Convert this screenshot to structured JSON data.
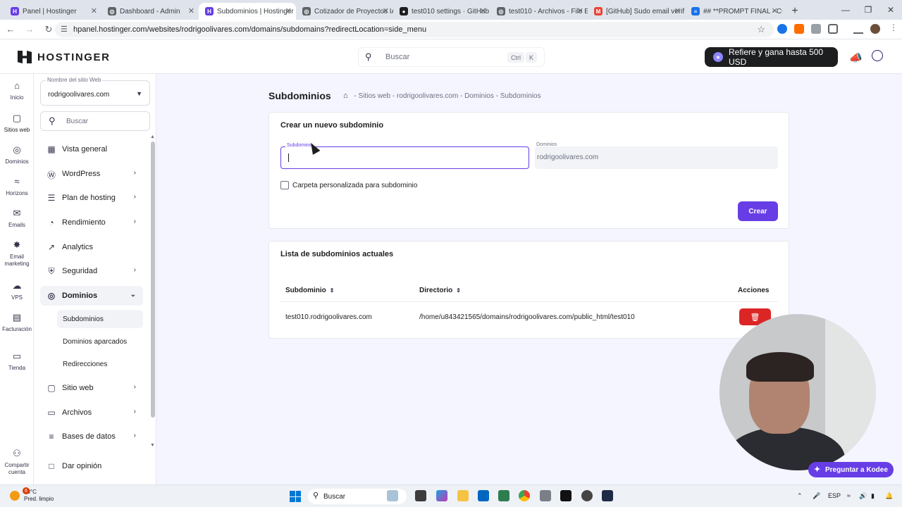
{
  "browser": {
    "tabs": [
      {
        "title": "Panel | Hostinger",
        "color": "#673de6",
        "glyph": "H"
      },
      {
        "title": "Dashboard - Admin",
        "color": "#5f6368",
        "glyph": "◎"
      },
      {
        "title": "Subdominios | Hostinger",
        "color": "#673de6",
        "glyph": "H",
        "active": true
      },
      {
        "title": "Cotizador de Proyectos IA",
        "color": "#5f6368",
        "glyph": "◎"
      },
      {
        "title": "test010 settings · GitHub",
        "color": "#1d1e20",
        "glyph": "●"
      },
      {
        "title": "test010 - Archivos - File E",
        "color": "#5f6368",
        "glyph": "◎"
      },
      {
        "title": "[GitHub] Sudo email verif",
        "color": "#ea4335",
        "glyph": "M"
      },
      {
        "title": "## **PROMPT FINAL - CO",
        "color": "#1a73e8",
        "glyph": "≡"
      }
    ],
    "url": "hpanel.hostinger.com/websites/rodrigoolivares.com/domains/subdomains?redirectLocation=side_menu"
  },
  "header": {
    "logo": "HOSTINGER",
    "search_placeholder": "Buscar",
    "search_kbd_1": "Ctrl",
    "search_kbd_2": "K",
    "refer_label": "Refiere y gana hasta 500 USD"
  },
  "rail": [
    {
      "label": "Inicio",
      "icon": "home-icon"
    },
    {
      "label": "Sitios web",
      "icon": "browser-icon",
      "active": true
    },
    {
      "label": "Dominios",
      "icon": "globe-icon"
    },
    {
      "label": "Horizons",
      "icon": "horizons-icon"
    },
    {
      "label": "Emails",
      "icon": "mail-icon"
    },
    {
      "label": "Email marketing",
      "icon": "sparkle-icon"
    },
    {
      "label": "VPS",
      "icon": "cloud-icon"
    },
    {
      "label": "Facturación",
      "icon": "billing-icon"
    },
    {
      "label": "Tienda",
      "icon": "store-icon"
    },
    {
      "label": "Compartir cuenta",
      "icon": "share-account-icon"
    }
  ],
  "sidebar": {
    "site_label": "Nombre del sitio Web",
    "site_value": "rodrigoolivares.com",
    "search_placeholder": "Buscar",
    "items": [
      {
        "label": "Vista general",
        "icon": "grid-icon",
        "chevron": false
      },
      {
        "label": "WordPress",
        "icon": "wordpress-icon",
        "chevron": true
      },
      {
        "label": "Plan de hosting",
        "icon": "server-icon",
        "chevron": true
      },
      {
        "label": "Rendimiento",
        "icon": "gauge-icon",
        "chevron": true
      },
      {
        "label": "Analytics",
        "icon": "chart-icon",
        "chevron": false
      },
      {
        "label": "Seguridad",
        "icon": "shield-icon",
        "chevron": true
      },
      {
        "label": "Dominios",
        "icon": "globe-icon",
        "chevron": true,
        "open": true
      }
    ],
    "sub_items": [
      {
        "label": "Subdominios",
        "active": true
      },
      {
        "label": "Dominios aparcados"
      },
      {
        "label": "Redirecciones"
      }
    ],
    "items_after": [
      {
        "label": "Sitio web",
        "icon": "window-icon",
        "chevron": true
      },
      {
        "label": "Archivos",
        "icon": "folder-icon",
        "chevron": true
      },
      {
        "label": "Bases de datos",
        "icon": "database-icon",
        "chevron": true
      },
      {
        "label": "Dar opinión",
        "icon": "feedback-icon",
        "chevron": false
      }
    ]
  },
  "page": {
    "title": "Subdominios",
    "breadcrumb": [
      "Sitios web",
      "rodrigoolivares.com",
      "Dominios",
      "Subdominios"
    ],
    "breadcrumb_sep": " - "
  },
  "create": {
    "title": "Crear un nuevo subdominio",
    "subdomain_label": "Subdominio",
    "subdomain_value": "",
    "domain_label": "Dominios",
    "domain_value": "rodrigoolivares.com",
    "checkbox_label": "Carpeta personalizada para subdominio",
    "checkbox_checked": false,
    "button": "Crear"
  },
  "list": {
    "title": "Lista de subdominios actuales",
    "columns": [
      "Subdominio",
      "Directorio",
      "Acciones"
    ],
    "rows": [
      {
        "subdomain": "test010.rodrigoolivares.com",
        "directory": "/home/u843421565/domains/rodrigoolivares.com/public_html/test010"
      }
    ]
  },
  "assistant": {
    "label": "Preguntar a Kodee"
  },
  "taskbar": {
    "weather_temp": "28°C",
    "weather_desc": "Pred. limpio",
    "weather_badge": "6",
    "search": "Buscar",
    "lang": "ESP"
  },
  "colors": {
    "accent": "#673de6",
    "danger": "#dc2626",
    "dark": "#1d1e20"
  }
}
